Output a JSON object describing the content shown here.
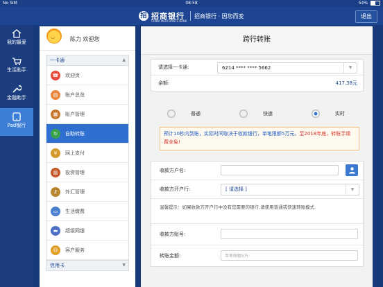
{
  "status_bar": {
    "carrier": "No SIM",
    "time": "08:58",
    "battery": "54%",
    "battery_level": 0.54
  },
  "header": {
    "logo_char": "招",
    "brand": "招商银行",
    "brand_en": "CHINA MERCHANTS BANK",
    "slogan": "招商银行 · 因您而变",
    "logout": "退出"
  },
  "sidebar": {
    "items": [
      {
        "label": "我的最爱",
        "icon": "home-icon",
        "active": false
      },
      {
        "label": "生活助手",
        "icon": "cart-icon",
        "active": false
      },
      {
        "label": "金融助手",
        "icon": "wrench-icon",
        "active": false
      },
      {
        "label": "Pad银行",
        "icon": "tablet-icon",
        "active": true
      }
    ]
  },
  "menu": {
    "welcome": "陈力 欢迎您",
    "group1": "一卡通",
    "items": [
      {
        "label": "欢迎页",
        "icon": "welcome-icon",
        "color": "#e8493d",
        "glyph": "☎"
      },
      {
        "label": "账户总览",
        "icon": "account-overview-icon",
        "color": "#e8863d",
        "glyph": "▤"
      },
      {
        "label": "账户管理",
        "icon": "account-manage-icon",
        "color": "#c9772e",
        "glyph": "▦"
      },
      {
        "label": "自助转账",
        "icon": "transfer-icon",
        "color": "#3aa34a",
        "glyph": "↻"
      },
      {
        "label": "网上支付",
        "icon": "online-pay-icon",
        "color": "#d59a2c",
        "glyph": "¥"
      },
      {
        "label": "投资管理",
        "icon": "investment-icon",
        "color": "#c45a2c",
        "glyph": "▥"
      },
      {
        "label": "外汇管理",
        "icon": "forex-icon",
        "color": "#b8862f",
        "glyph": "£"
      },
      {
        "label": "生活缴费",
        "icon": "bill-pay-icon",
        "color": "#4a7fd0",
        "glyph": "▭"
      },
      {
        "label": "超级网银",
        "icon": "super-ebank-icon",
        "color": "#4b6fc4",
        "glyph": "▬"
      },
      {
        "label": "客户服务",
        "icon": "customer-service-icon",
        "color": "#e0a02a",
        "glyph": "☺"
      }
    ],
    "active_index": 3,
    "group2": "信用卡"
  },
  "panel": {
    "title": "跨行转账",
    "card_label": "请选择一卡通:",
    "card_value": "6214 **** **** 5662",
    "balance_label": "余额:",
    "balance_value": "417.38元",
    "modes": [
      "普通",
      "快速",
      "实时"
    ],
    "selected_mode": 2,
    "notice_blue": "预计10秒内到账，实际时间取决于收款银行，单笔限额5万元。",
    "notice_red": "至2018年底，转账手续费全免!",
    "payee_name_label": "收款方户名:",
    "payee_bank_label": "收款方开户行:",
    "payee_bank_value": "[ 请选择 ]",
    "hint": "温馨提示：如果收款方开户行中没有您需要的银行,请使用普通或快速转账模式.",
    "payee_account_label": "收款方账号:",
    "amount_label": "转账金额:",
    "amount_placeholder": "单笔限额5万"
  }
}
